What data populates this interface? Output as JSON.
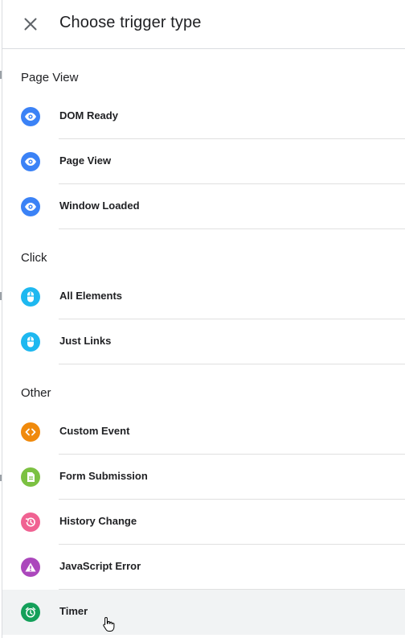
{
  "header": {
    "title": "Choose trigger type"
  },
  "sections": [
    {
      "label": "Page View",
      "items": [
        {
          "label": "DOM Ready",
          "icon": "eye-icon",
          "color": "#3b82f6"
        },
        {
          "label": "Page View",
          "icon": "eye-icon",
          "color": "#3b82f6"
        },
        {
          "label": "Window Loaded",
          "icon": "eye-icon",
          "color": "#3b82f6"
        }
      ]
    },
    {
      "label": "Click",
      "items": [
        {
          "label": "All Elements",
          "icon": "mouse-icon",
          "color": "#1eb8f0"
        },
        {
          "label": "Just Links",
          "icon": "mouse-icon",
          "color": "#1eb8f0"
        }
      ]
    },
    {
      "label": "Other",
      "items": [
        {
          "label": "Custom Event",
          "icon": "code-icon",
          "color": "#f08a0c"
        },
        {
          "label": "Form Submission",
          "icon": "document-icon",
          "color": "#7cc142"
        },
        {
          "label": "History Change",
          "icon": "history-icon",
          "color": "#f06292"
        },
        {
          "label": "JavaScript Error",
          "icon": "warning-icon",
          "color": "#ab47bc"
        },
        {
          "label": "Timer",
          "icon": "alarm-icon",
          "color": "#14a05a"
        }
      ]
    }
  ]
}
